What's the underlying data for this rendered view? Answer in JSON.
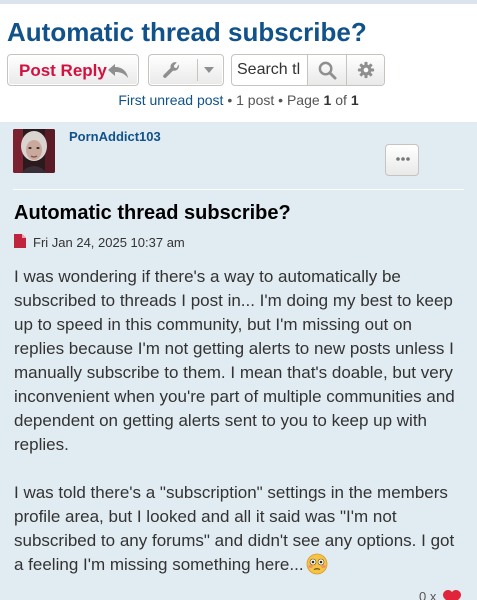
{
  "topic": {
    "title": "Automatic thread subscribe?"
  },
  "toolbar": {
    "post_reply_label": "Post Reply",
    "search_placeholder": "Search this topic…",
    "search_value": "Search tl"
  },
  "pagination": {
    "first_unread": "First unread post",
    "sep1": " • ",
    "post_count": "1 post",
    "sep2": " • ",
    "page_word": "Page ",
    "page_current": "1",
    "of_word": " of ",
    "page_total": "1"
  },
  "post": {
    "author": "PornAddict103",
    "title": "Automatic thread subscribe?",
    "date": "Fri Jan 24, 2025 10:37 am",
    "paragraph_1": "I was wondering if there's a way to automatically be subscribed to threads I post in... I'm doing my best to keep up to speed in this community, but I'm missing out on replies because I'm not getting alerts to new posts unless I manually subscribe to them. I mean that's doable, but very inconvenient when you're part of multiple communities and dependent on getting alerts sent to you to keep up with replies.",
    "paragraph_2": "I was told there's a \"subscription\" settings in the members profile area, but I looked and all it said was \"I'm not subscribed to any forums\" and didn't see any options. I got a feeling I'm missing something here...",
    "reaction_count": "0",
    "reaction_sep": " x"
  },
  "icons": {
    "reply": "reply-arrow-icon",
    "tools": "wrench-icon",
    "dropdown": "caret-down-icon",
    "search": "search-icon",
    "advanced": "gear-icon",
    "more": "dots-icon",
    "post": "post-file-icon",
    "emoji": "flushed-face-emoji",
    "reaction": "heart-icon"
  },
  "colors": {
    "link": "#105289",
    "post_reply": "#d31141",
    "post_bg": "#e1ebf2",
    "heart": "#e0243a"
  }
}
